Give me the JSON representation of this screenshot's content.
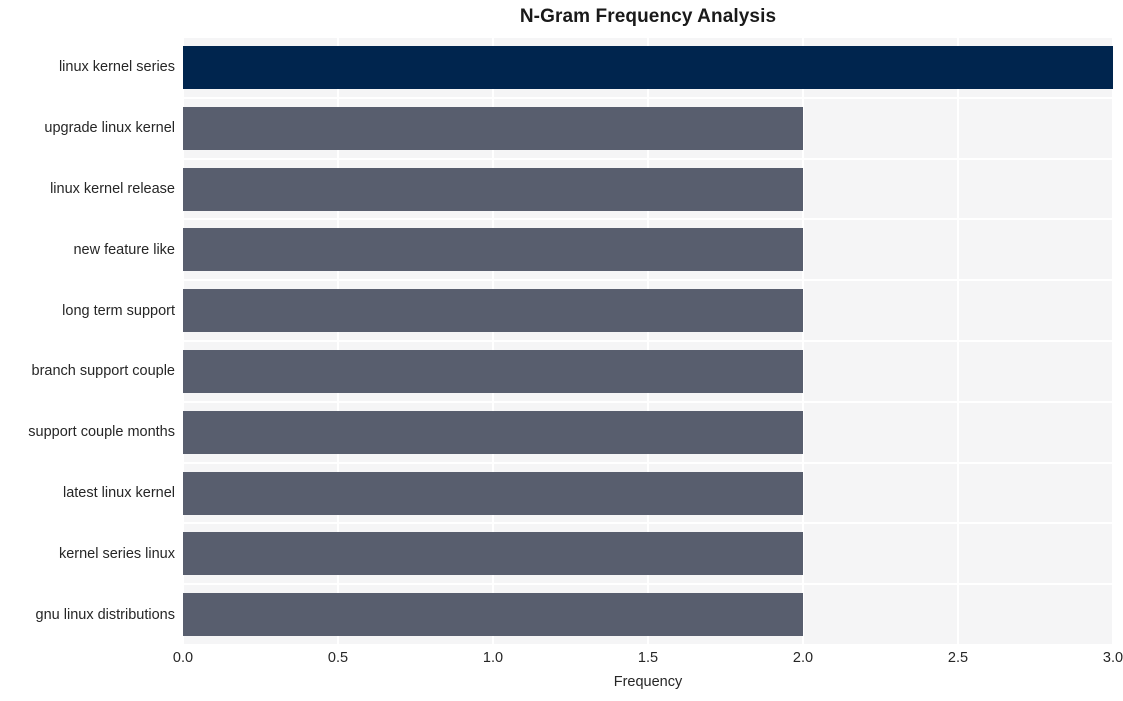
{
  "chart_data": {
    "type": "bar",
    "orientation": "horizontal",
    "title": "N-Gram Frequency Analysis",
    "xlabel": "Frequency",
    "ylabel": "",
    "xlim": [
      0,
      3.0
    ],
    "xticks": [
      "0.0",
      "0.5",
      "1.0",
      "1.5",
      "2.0",
      "2.5",
      "3.0"
    ],
    "xtick_values": [
      0,
      0.5,
      1,
      1.5,
      2,
      2.5,
      3
    ],
    "grid": true,
    "legend": null,
    "categories": [
      "linux kernel series",
      "upgrade linux kernel",
      "linux kernel release",
      "new feature like",
      "long term support",
      "branch support couple",
      "support couple months",
      "latest linux kernel",
      "kernel series linux",
      "gnu linux distributions"
    ],
    "values": [
      3,
      2,
      2,
      2,
      2,
      2,
      2,
      2,
      2,
      2
    ],
    "bar_colors": [
      "#00254e",
      "#585e6e",
      "#585e6e",
      "#585e6e",
      "#585e6e",
      "#585e6e",
      "#585e6e",
      "#585e6e",
      "#585e6e",
      "#585e6e"
    ]
  },
  "style": {
    "plot_background": "#f5f5f6",
    "figure_background": "#ffffff",
    "gridline_color": "#ffffff",
    "text_color": "#262626",
    "title_color": "#1a1a1a"
  }
}
